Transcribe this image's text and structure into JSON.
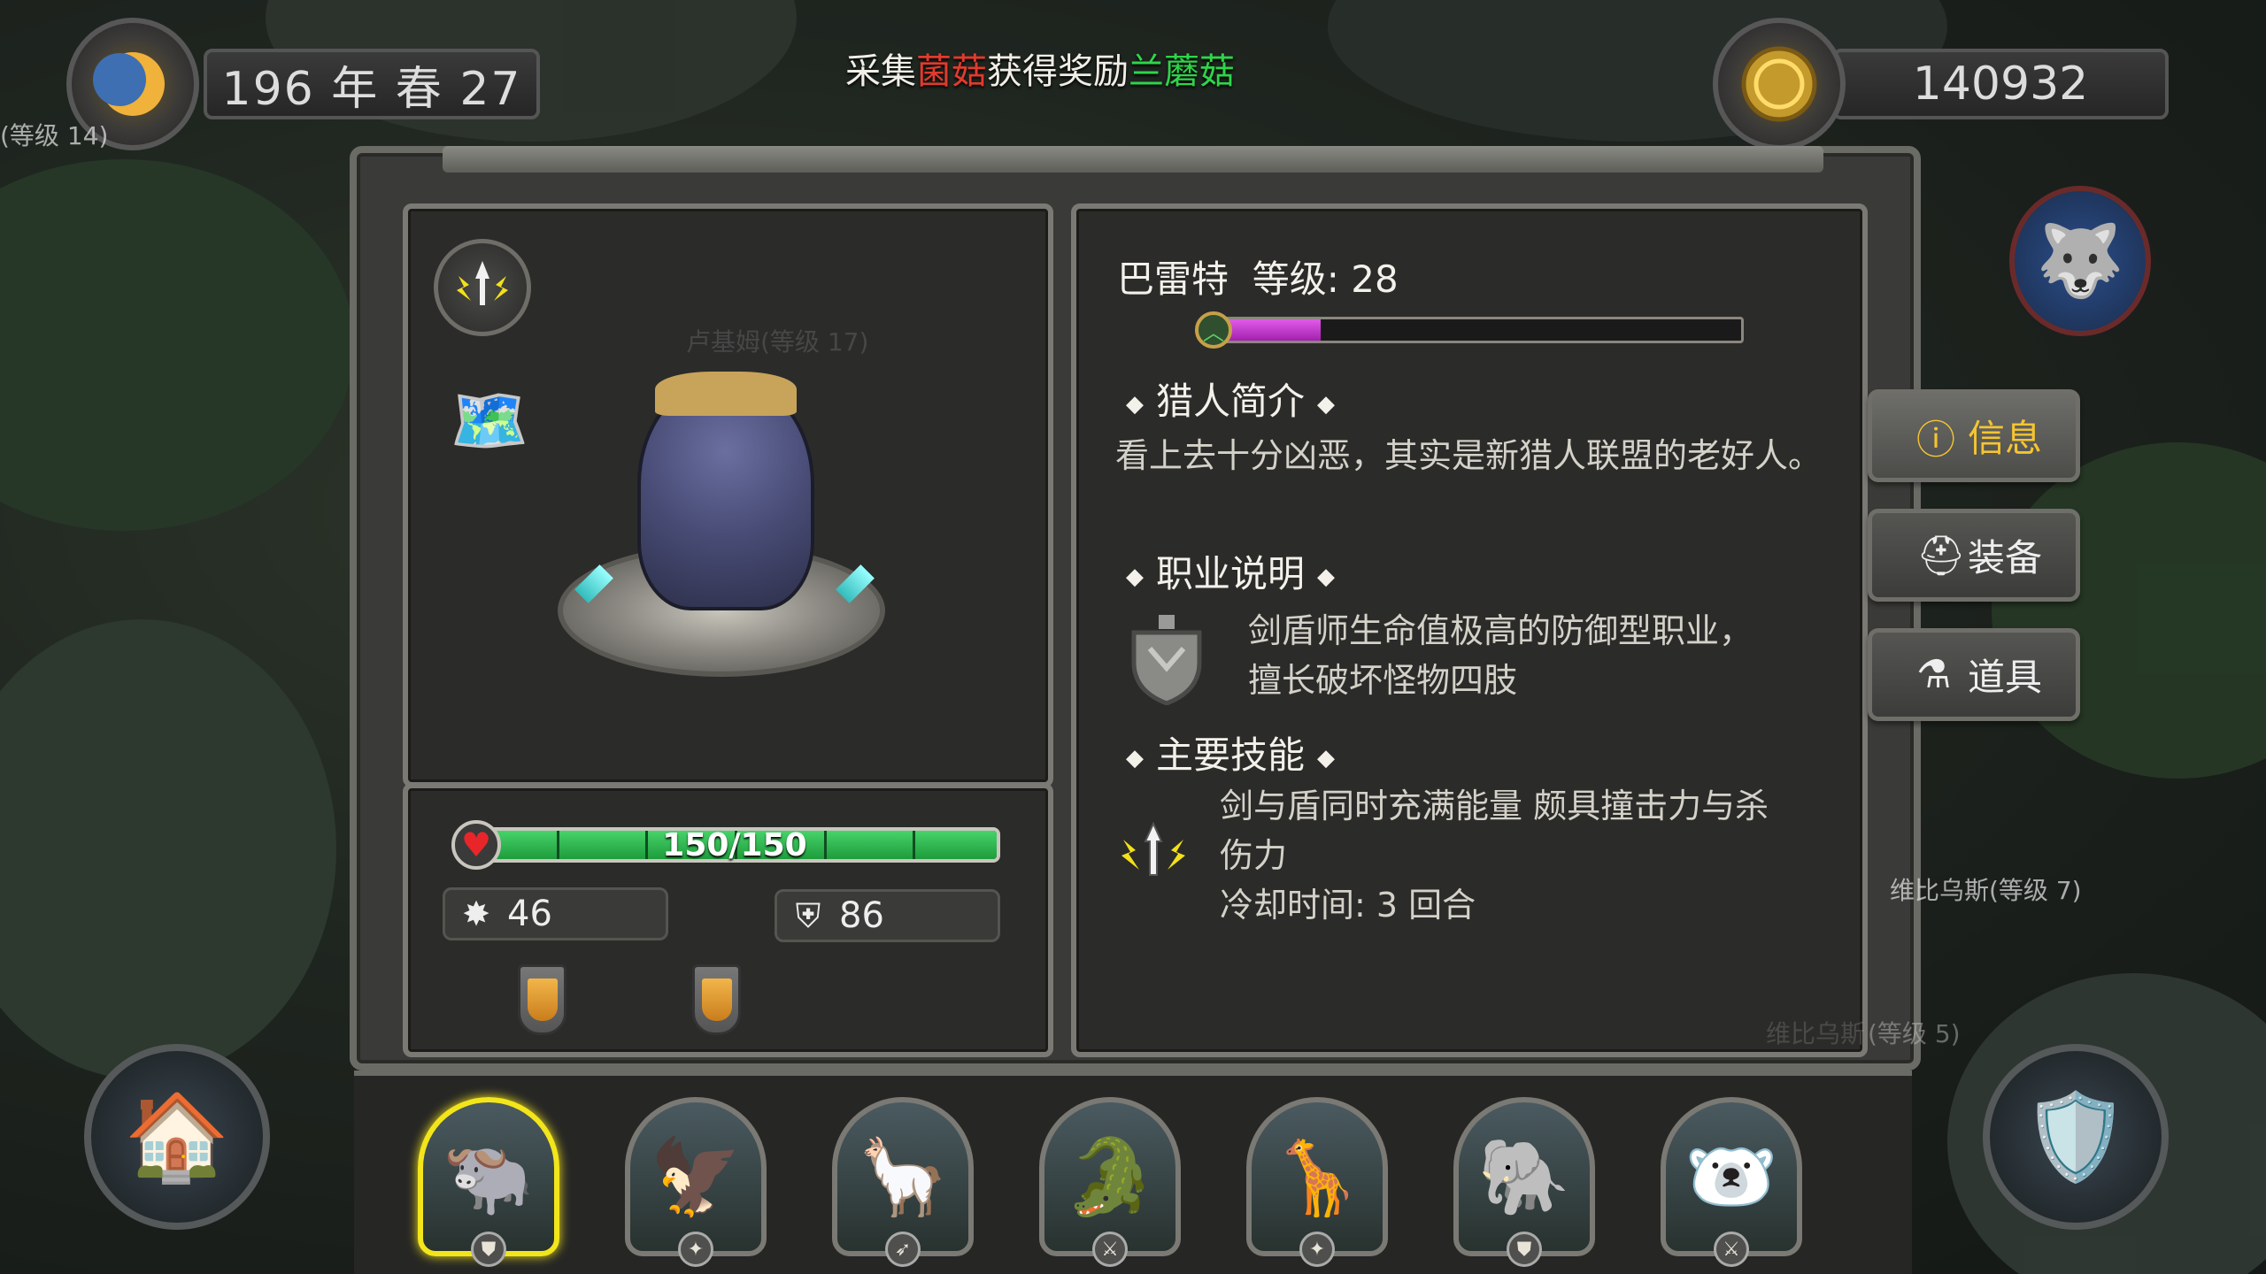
{
  "header": {
    "date": "196 年 春 27",
    "coins": "140932",
    "ticker": {
      "prefix": "采集",
      "item": "菌菇",
      "middle": "获得奖励",
      "reward": "兰蘑菇"
    }
  },
  "scene_labels": {
    "top_left_npc": "(等级 14)",
    "ghost_npc": "卢基姆(等级 17)",
    "npc_right": "维比乌斯(等级 7)",
    "npc_right_ghost_name": "维比乌斯",
    "npc_right_ghost_level": "(等级 5)"
  },
  "hero": {
    "name": "巴雷特",
    "level_label": "等级: 28",
    "xp_fraction": 0.19,
    "hp_text": "150/150",
    "hp_fraction": 1.0,
    "attack": "46",
    "defense": "86"
  },
  "info": {
    "intro_heading": "猎人简介",
    "intro_text": "看上去十分凶恶，其实是新猎人联盟的老好人。",
    "job_heading": "职业说明",
    "job_line1": "剑盾师生命值极高的防御型职业，",
    "job_line2": "擅长破坏怪物四肢",
    "skill_heading": "主要技能",
    "skill_line1": "剑与盾同时充满能量 颇具撞击力与杀",
    "skill_line2": "伤力",
    "cooldown": "冷却时间: 3 回合"
  },
  "tabs": [
    {
      "label": "信息",
      "icon": "info-icon",
      "active": true
    },
    {
      "label": "装备",
      "icon": "helmet-icon",
      "active": false
    },
    {
      "label": "道具",
      "icon": "potion-icon",
      "active": false
    }
  ],
  "roster": [
    {
      "name": "buffalo-hero",
      "glyph": "🐃",
      "badge": "shield",
      "selected": true
    },
    {
      "name": "eagle-hero",
      "glyph": "🦅",
      "badge": "claw",
      "selected": false
    },
    {
      "name": "alpaca-hero",
      "glyph": "🦙",
      "badge": "bow",
      "selected": false
    },
    {
      "name": "crocodile-hero",
      "glyph": "🐊",
      "badge": "sword",
      "selected": false
    },
    {
      "name": "giraffe-hero",
      "glyph": "🦒",
      "badge": "claw",
      "selected": false
    },
    {
      "name": "elephant-hero",
      "glyph": "🐘",
      "badge": "shield",
      "selected": false
    },
    {
      "name": "polar-bear-hero",
      "glyph": "🐻‍❄️",
      "badge": "sword",
      "selected": false
    }
  ],
  "colors": {
    "hp": "#2fbf4f",
    "xp": "#c23ad0",
    "active_tab": "#f5c531",
    "ticker_item": "#e23a2e",
    "ticker_reward": "#2fd44a",
    "selected_portrait": "#f3e51b"
  }
}
